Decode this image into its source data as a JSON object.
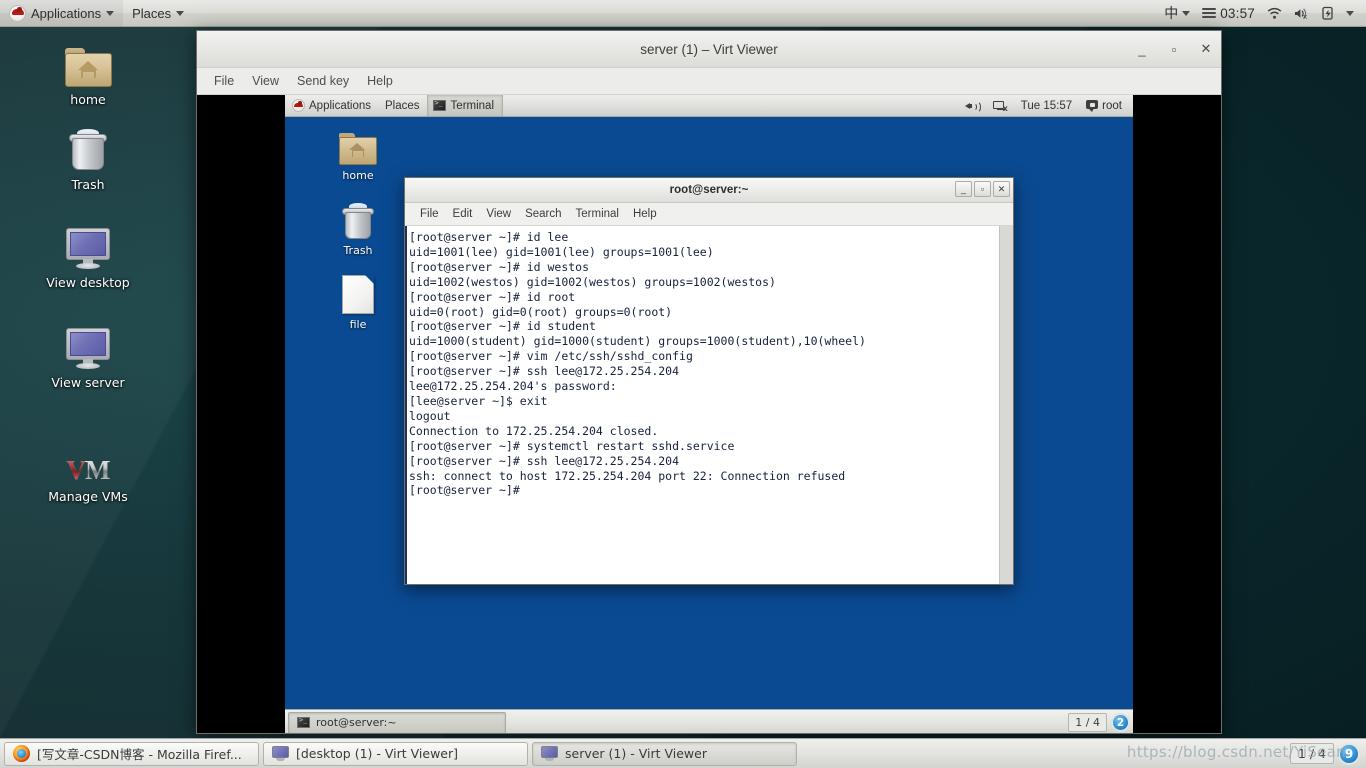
{
  "host_panel": {
    "logo_icon": "redhat-logo-icon",
    "menus": [
      {
        "label": "Applications",
        "icon": "chevron-down-icon"
      },
      {
        "label": "Places",
        "icon": "chevron-down-icon"
      }
    ],
    "ime_label": "中",
    "clock": "03:57",
    "tray_icons": [
      "hamburger-menu-icon",
      "wifi-icon",
      "volume-muted-icon",
      "battery-charging-icon",
      "chevron-down-icon"
    ]
  },
  "host_desktop": {
    "icons": [
      {
        "label": "home",
        "icon": "home-folder-icon"
      },
      {
        "label": "Trash",
        "icon": "trash-icon"
      },
      {
        "label": "View desktop",
        "icon": "monitor-icon"
      },
      {
        "label": "View server",
        "icon": "monitor-icon"
      },
      {
        "label": "Manage VMs",
        "icon": "vmware-logo-icon"
      }
    ]
  },
  "host_taskbar": {
    "tasks": [
      {
        "label": "[写文章-CSDN博客 - Mozilla Firef...",
        "icon": "firefox-icon",
        "active": false
      },
      {
        "label": "[desktop (1) - Virt Viewer]",
        "icon": "virt-viewer-icon",
        "active": false
      },
      {
        "label": "server (1) - Virt Viewer",
        "icon": "virt-viewer-icon",
        "active": true
      }
    ],
    "workspace": "1 / 4",
    "badge": "9",
    "watermark": "https://blog.csdn.net/YiSean"
  },
  "virt_viewer": {
    "title": "server (1) – Virt Viewer",
    "window_buttons": {
      "minimize": "_",
      "maximize": "▫",
      "close": "✕"
    },
    "menus": [
      "File",
      "View",
      "Send key",
      "Help"
    ]
  },
  "guest_panel": {
    "logo_icon": "redhat-logo-icon",
    "menus": [
      "Applications",
      "Places"
    ],
    "active_window": {
      "label": "Terminal",
      "icon": "terminal-icon"
    },
    "clock": "Tue 15:57",
    "user": "root",
    "tray_icons": [
      "volume-icon",
      "network-disconnected-icon",
      "user-icon"
    ]
  },
  "guest_desktop": {
    "icons": [
      {
        "label": "home",
        "icon": "home-folder-icon"
      },
      {
        "label": "Trash",
        "icon": "trash-icon"
      },
      {
        "label": "file",
        "icon": "document-icon"
      }
    ]
  },
  "guest_taskbar": {
    "tasks": [
      {
        "label": "root@server:~",
        "icon": "terminal-icon"
      }
    ],
    "workspace": "1 / 4",
    "badge": "2"
  },
  "terminal": {
    "title": "root@server:~",
    "window_buttons": {
      "minimize": "_",
      "maximize": "▫",
      "close": "✕"
    },
    "menus": [
      "File",
      "Edit",
      "View",
      "Search",
      "Terminal",
      "Help"
    ],
    "content": "[root@server ~]# id lee\nuid=1001(lee) gid=1001(lee) groups=1001(lee)\n[root@server ~]# id westos\nuid=1002(westos) gid=1002(westos) groups=1002(westos)\n[root@server ~]# id root\nuid=0(root) gid=0(root) groups=0(root)\n[root@server ~]# id student\nuid=1000(student) gid=1000(student) groups=1000(student),10(wheel)\n[root@server ~]# vim /etc/ssh/sshd_config\n[root@server ~]# ssh lee@172.25.254.204\nlee@172.25.254.204's password:\n[lee@server ~]$ exit\nlogout\nConnection to 172.25.254.204 closed.\n[root@server ~]# systemctl restart sshd.service\n[root@server ~]# ssh lee@172.25.254.204\nssh: connect to host 172.25.254.204 port 22: Connection refused\n[root@server ~]# "
  },
  "colors": {
    "guest_desktop_bg": "#0a4a92",
    "terminal_text": "#16213c",
    "terminal_bg": "#ffffff",
    "badge_blue": "#2e8fd4"
  }
}
